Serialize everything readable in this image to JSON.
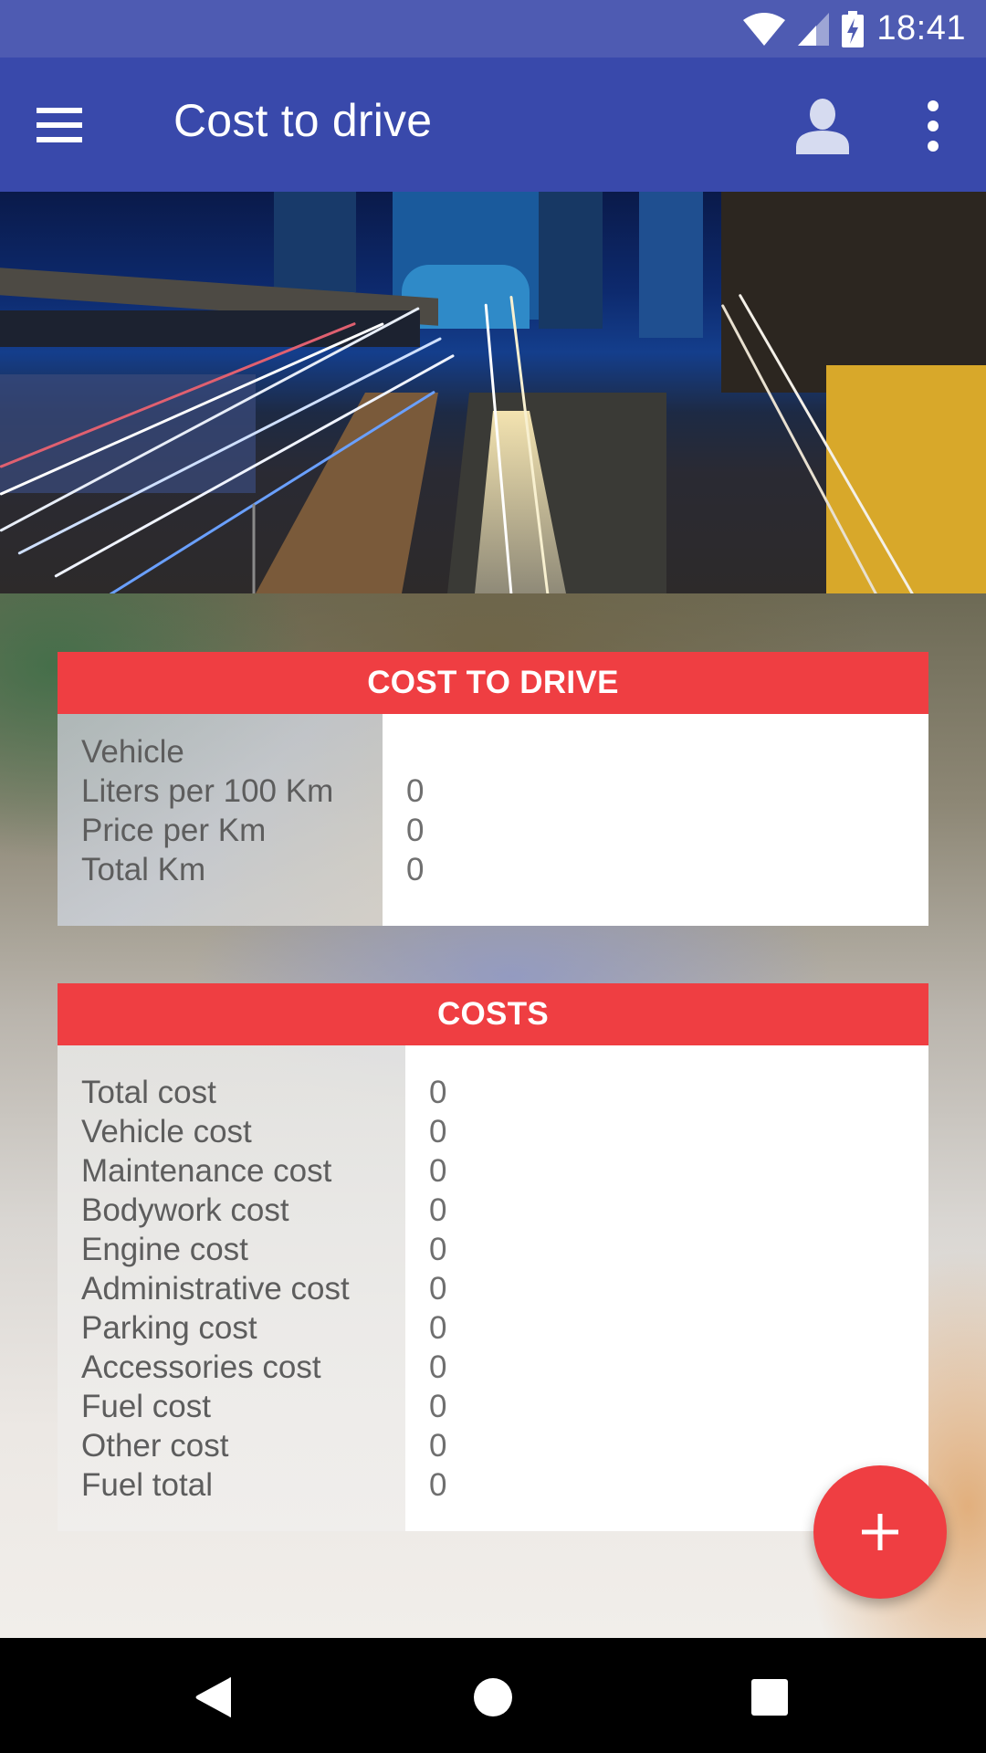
{
  "status_bar": {
    "time": "18:41",
    "icons": [
      "wifi-icon",
      "cellular-signal-icon",
      "battery-charging-icon"
    ]
  },
  "app_bar": {
    "title": "Cost to drive",
    "menu_icon": "hamburger-menu-icon",
    "account_icon": "account-icon",
    "more_icon": "more-vert-icon",
    "background_color": "#3949ab"
  },
  "hero": {
    "image": "night-city-highway-light-trails"
  },
  "cost_to_drive_card": {
    "title": "COST TO DRIVE",
    "header_color": "#ef3e42",
    "rows": [
      {
        "label": "Vehicle",
        "value": ""
      },
      {
        "label": "Liters per 100 Km",
        "value": "0"
      },
      {
        "label": "Price per Km",
        "value": "0"
      },
      {
        "label": "Total Km",
        "value": "0"
      }
    ]
  },
  "costs_card": {
    "title": "COSTS",
    "header_color": "#ef3e42",
    "rows": [
      {
        "label": "Total cost",
        "value": "0"
      },
      {
        "label": "Vehicle cost",
        "value": "0"
      },
      {
        "label": "Maintenance cost",
        "value": "0"
      },
      {
        "label": "Bodywork cost",
        "value": "0"
      },
      {
        "label": "Engine cost",
        "value": "0"
      },
      {
        "label": "Administrative cost",
        "value": "0"
      },
      {
        "label": "Parking cost",
        "value": "0"
      },
      {
        "label": "Accessories cost",
        "value": "0"
      },
      {
        "label": "Fuel cost",
        "value": "0"
      },
      {
        "label": "Other cost",
        "value": "0"
      },
      {
        "label": "Fuel total",
        "value": "0"
      }
    ]
  },
  "fab": {
    "icon": "plus-icon",
    "color": "#ef3e42"
  },
  "nav_bar": {
    "buttons": [
      "back-icon",
      "home-icon",
      "recents-icon"
    ]
  }
}
